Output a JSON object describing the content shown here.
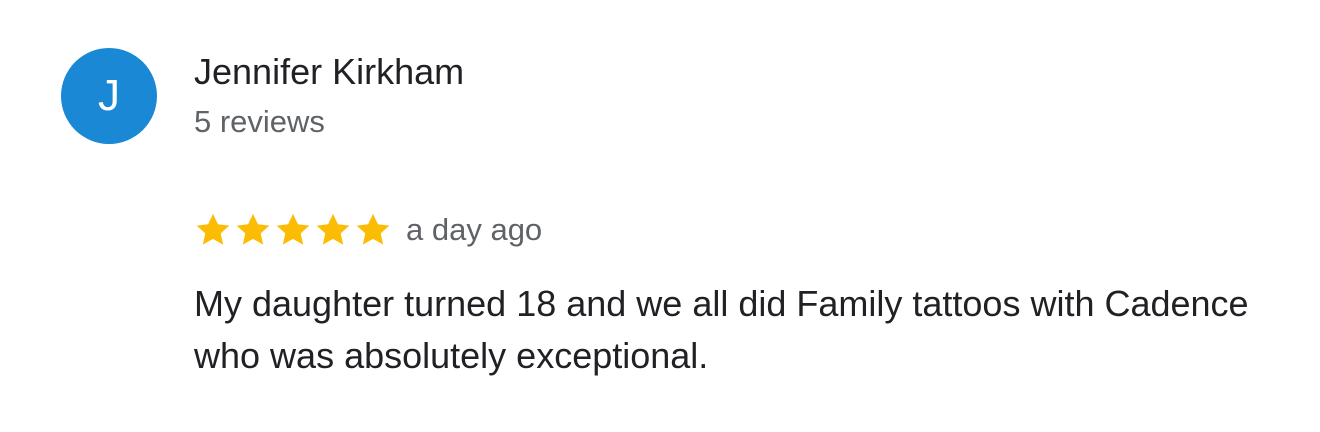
{
  "review": {
    "author": {
      "initial": "J",
      "name": "Jennifer Kirkham",
      "review_count": "5 reviews",
      "avatar_color": "#1a88d4"
    },
    "rating": {
      "stars": 5,
      "max_stars": 5,
      "star_color": "#fbbc04",
      "icon": "star-icon"
    },
    "timestamp": "a day ago",
    "text": "My daughter turned 18 and we all did Family tattoos with Cadence who was absolutely exceptional."
  }
}
